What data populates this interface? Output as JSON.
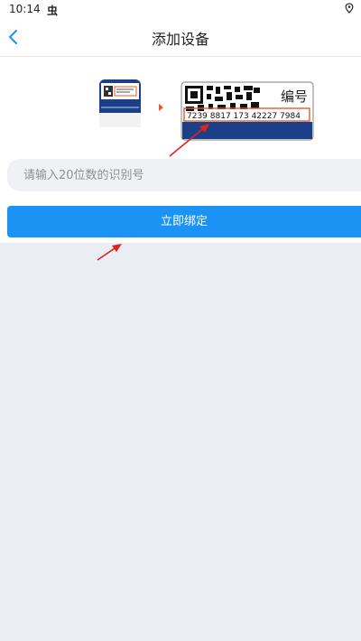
{
  "status_bar": {
    "time": "10:14",
    "notification_glyph": "虫",
    "icons": [
      "bug-icon",
      "location-icon"
    ]
  },
  "nav": {
    "title": "添加设备",
    "back_icon": "chevron-left-icon"
  },
  "illustration": {
    "label_text": "编号",
    "serial_example": "7239 8817 173 42227 7984"
  },
  "form": {
    "id_input_placeholder": "请输入20位数的识别号",
    "id_input_value": "",
    "bind_button_label": "立即绑定"
  },
  "colors": {
    "primary": "#1b93f5",
    "background": "#eaedf2",
    "device_blue": "#1c4088",
    "highlight_orange": "#e55a2b",
    "arrow_red": "#e0221c"
  }
}
